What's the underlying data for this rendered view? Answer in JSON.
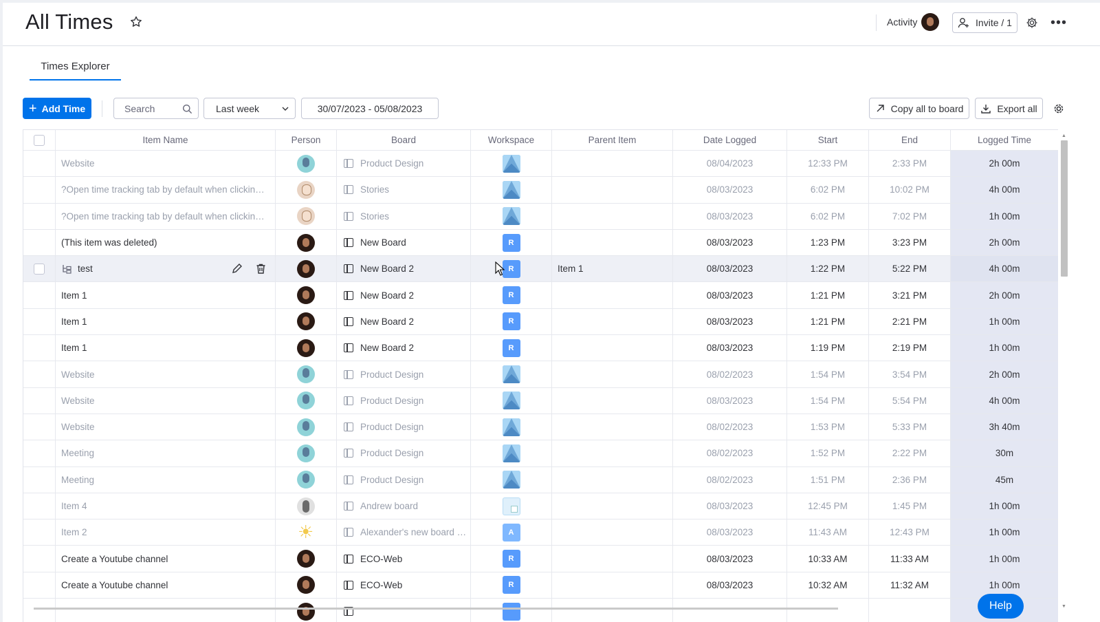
{
  "header": {
    "title": "All Times",
    "activity_label": "Activity",
    "invite_label": "Invite / 1"
  },
  "tabs": [
    {
      "label": "Times Explorer"
    }
  ],
  "toolbar": {
    "add_label": "Add Time",
    "search_placeholder": "Search",
    "period": "Last week",
    "date_range": "30/07/2023 - 05/08/2023",
    "copy_label": "Copy all to board",
    "export_label": "Export all"
  },
  "columns": [
    "Item Name",
    "Person",
    "Board",
    "Workspace",
    "Parent Item",
    "Date Logged",
    "Start",
    "End",
    "Logged Time"
  ],
  "rows": [
    {
      "name": "Website",
      "avatar": "teal",
      "board": "Product Design",
      "ws": "img",
      "ws_label": "",
      "parent": "",
      "date": "08/04/2023",
      "start": "12:33 PM",
      "end": "2:33 PM",
      "logged": "2h 00m",
      "muted": true
    },
    {
      "name": "?Open time tracking tab by default when clicking on the time tracking column",
      "avatar": "cartoon",
      "board": "Stories",
      "ws": "img",
      "ws_label": "",
      "parent": "",
      "date": "08/03/2023",
      "start": "6:02 PM",
      "end": "10:02 PM",
      "logged": "4h 00m",
      "muted": true
    },
    {
      "name": "?Open time tracking tab by default when clicking on the time tracking column",
      "avatar": "cartoon",
      "board": "Stories",
      "ws": "img",
      "ws_label": "",
      "parent": "",
      "date": "08/03/2023",
      "start": "6:02 PM",
      "end": "7:02 PM",
      "logged": "1h 00m",
      "muted": true
    },
    {
      "name": "(This item was deleted)",
      "avatar": "dark",
      "board": "New Board",
      "ws": "r",
      "ws_label": "R",
      "parent": "",
      "date": "08/03/2023",
      "start": "1:23 PM",
      "end": "3:23 PM",
      "logged": "2h 00m",
      "muted": false
    },
    {
      "name": "test",
      "avatar": "dark",
      "board": "New Board 2",
      "ws": "r",
      "ws_label": "R",
      "parent": "Item 1",
      "date": "08/03/2023",
      "start": "1:22 PM",
      "end": "5:22 PM",
      "logged": "4h 00m",
      "muted": false,
      "hover": true,
      "subitem": true
    },
    {
      "name": "Item 1",
      "avatar": "dark",
      "board": "New Board 2",
      "ws": "r",
      "ws_label": "R",
      "parent": "",
      "date": "08/03/2023",
      "start": "1:21 PM",
      "end": "3:21 PM",
      "logged": "2h 00m",
      "muted": false
    },
    {
      "name": "Item 1",
      "avatar": "dark",
      "board": "New Board 2",
      "ws": "r",
      "ws_label": "R",
      "parent": "",
      "date": "08/03/2023",
      "start": "1:21 PM",
      "end": "2:21 PM",
      "logged": "1h 00m",
      "muted": false
    },
    {
      "name": "Item 1",
      "avatar": "dark",
      "board": "New Board 2",
      "ws": "r",
      "ws_label": "R",
      "parent": "",
      "date": "08/03/2023",
      "start": "1:19 PM",
      "end": "2:19 PM",
      "logged": "1h 00m",
      "muted": false
    },
    {
      "name": "Website",
      "avatar": "teal",
      "board": "Product Design",
      "ws": "img",
      "ws_label": "",
      "parent": "",
      "date": "08/02/2023",
      "start": "1:54 PM",
      "end": "3:54 PM",
      "logged": "2h 00m",
      "muted": true
    },
    {
      "name": "Website",
      "avatar": "teal",
      "board": "Product Design",
      "ws": "img",
      "ws_label": "",
      "parent": "",
      "date": "08/03/2023",
      "start": "1:54 PM",
      "end": "5:54 PM",
      "logged": "4h 00m",
      "muted": true
    },
    {
      "name": "Website",
      "avatar": "teal",
      "board": "Product Design",
      "ws": "img",
      "ws_label": "",
      "parent": "",
      "date": "08/02/2023",
      "start": "1:53 PM",
      "end": "5:33 PM",
      "logged": "3h 40m",
      "muted": true
    },
    {
      "name": "Meeting",
      "avatar": "teal",
      "board": "Product Design",
      "ws": "img",
      "ws_label": "",
      "parent": "",
      "date": "08/02/2023",
      "start": "1:52 PM",
      "end": "2:22 PM",
      "logged": "30m",
      "muted": true
    },
    {
      "name": "Meeting",
      "avatar": "teal",
      "board": "Product Design",
      "ws": "img",
      "ws_label": "",
      "parent": "",
      "date": "08/02/2023",
      "start": "1:51 PM",
      "end": "2:36 PM",
      "logged": "45m",
      "muted": true
    },
    {
      "name": "Item 4",
      "avatar": "grey",
      "board": "Andrew board",
      "ws": "lite",
      "ws_label": "",
      "parent": "",
      "date": "08/03/2023",
      "start": "12:45 PM",
      "end": "1:45 PM",
      "logged": "1h 00m",
      "muted": true
    },
    {
      "name": "Item 2",
      "avatar": "sun",
      "board": "Alexander's new board for testing",
      "ws": "a",
      "ws_label": "A",
      "parent": "",
      "date": "08/03/2023",
      "start": "11:43 AM",
      "end": "12:43 PM",
      "logged": "1h 00m",
      "muted": true
    },
    {
      "name": "Create a Youtube channel",
      "avatar": "dark",
      "board": "ECO-Web",
      "ws": "r",
      "ws_label": "R",
      "parent": "",
      "date": "08/03/2023",
      "start": "10:33 AM",
      "end": "11:33 AM",
      "logged": "1h 00m",
      "muted": false
    },
    {
      "name": "Create a Youtube channel",
      "avatar": "dark",
      "board": "ECO-Web",
      "ws": "r",
      "ws_label": "R",
      "parent": "",
      "date": "08/03/2023",
      "start": "10:32 AM",
      "end": "11:32 AM",
      "logged": "1h 00m",
      "muted": false
    },
    {
      "name": "",
      "avatar": "dark",
      "board": "",
      "ws": "r",
      "ws_label": "",
      "parent": "",
      "date": "",
      "start": "",
      "end": "",
      "logged": "",
      "muted": false
    }
  ],
  "help_label": "Help"
}
